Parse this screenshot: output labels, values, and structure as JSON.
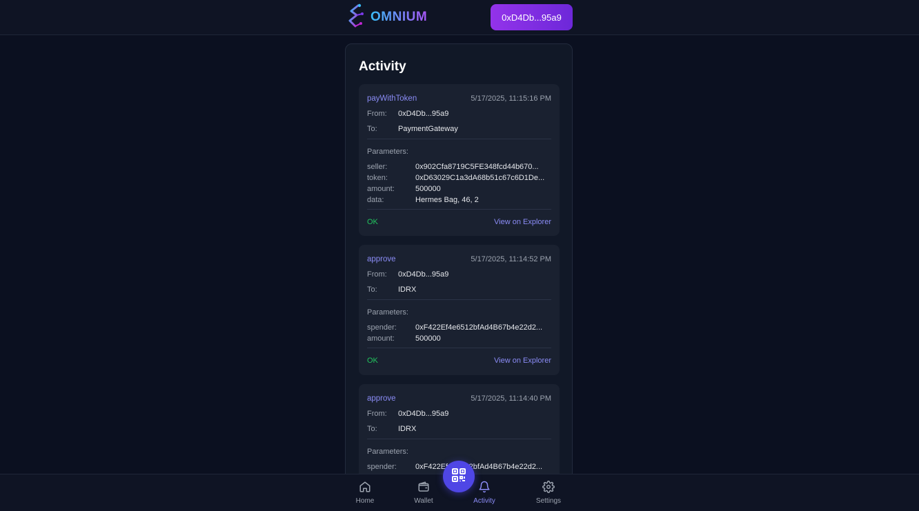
{
  "header": {
    "brand": "OMNIUM",
    "wallet_label": "0xD4Db...95a9"
  },
  "activity": {
    "title": "Activity",
    "from_label": "From:",
    "to_label": "To:",
    "params_label": "Parameters:",
    "explorer_label": "View on Explorer",
    "transactions": [
      {
        "function": "payWithToken",
        "timestamp": "5/17/2025, 11:15:16 PM",
        "from": "0xD4Db...95a9",
        "to": "PaymentGateway",
        "params": [
          {
            "name": "seller:",
            "value": "0x902Cfa8719C5FE348fcd44b670..."
          },
          {
            "name": "token:",
            "value": "0xD63029C1a3dA68b51c67c6D1De..."
          },
          {
            "name": "amount:",
            "value": "500000"
          },
          {
            "name": "data:",
            "value": "Hermes Bag, 46, 2"
          }
        ],
        "status": "OK"
      },
      {
        "function": "approve",
        "timestamp": "5/17/2025, 11:14:52 PM",
        "from": "0xD4Db...95a9",
        "to": "IDRX",
        "params": [
          {
            "name": "spender:",
            "value": "0xF422Ef4e6512bfAd4B67b4e22d2..."
          },
          {
            "name": "amount:",
            "value": "500000"
          }
        ],
        "status": "OK"
      },
      {
        "function": "approve",
        "timestamp": "5/17/2025, 11:14:40 PM",
        "from": "0xD4Db...95a9",
        "to": "IDRX",
        "params": [
          {
            "name": "spender:",
            "value": "0xF422Ef4e6512bfAd4B67b4e22d2..."
          }
        ]
      }
    ]
  },
  "nav": {
    "home": "Home",
    "wallet": "Wallet",
    "activity": "Activity",
    "settings": "Settings",
    "active_color": "#8b8cf6"
  },
  "icons": {
    "brand": "omnium-logo-icon",
    "home": "home-icon",
    "wallet": "wallet-icon",
    "scan": "qr-code-icon",
    "activity": "bell-icon",
    "settings": "gear-icon"
  }
}
